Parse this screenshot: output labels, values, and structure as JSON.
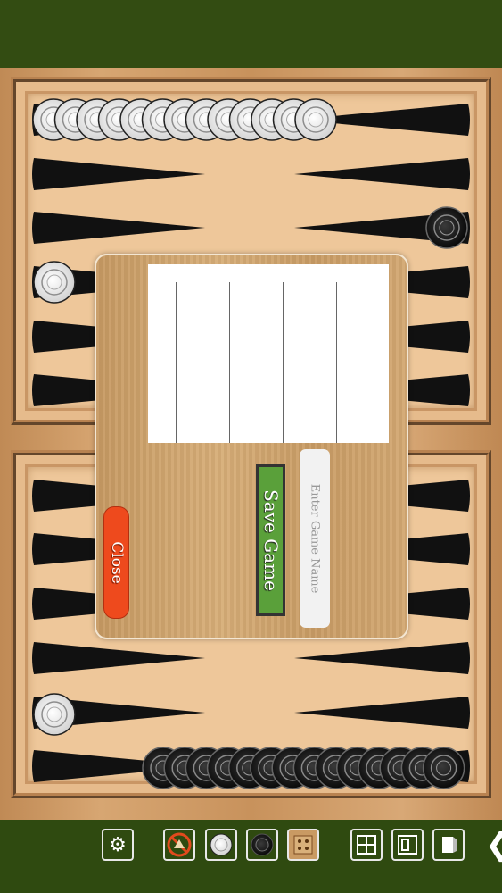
{
  "dialog": {
    "save_label": "Save Game",
    "close_label": "Close",
    "name_placeholder": "Enter Game Name"
  },
  "toolbar": {
    "icons": [
      "gear-icon",
      "no-sound-icon",
      "white-checker-icon",
      "black-checker-icon",
      "dice-icon",
      "board-layout-icon",
      "card-icon",
      "door-icon",
      "back-chevron-icon"
    ]
  },
  "board": {
    "white_stacks": [
      {
        "point": "top-left-row1",
        "count": 13
      },
      {
        "point": "top-left-row4",
        "count": 1
      },
      {
        "point": "bottom-left-row5",
        "count": 1
      }
    ],
    "black_stacks": [
      {
        "point": "top-right-row3",
        "count": 1
      },
      {
        "point": "bottom-row6",
        "count": 14
      }
    ]
  },
  "colors": {
    "bar": "#334c12",
    "checker_white": "#f4f4f4",
    "checker_black": "#151515",
    "save": "#5aa03a",
    "close": "#ee4a1d"
  }
}
